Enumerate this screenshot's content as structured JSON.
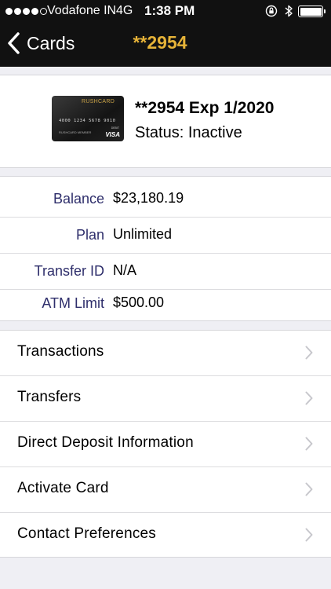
{
  "status_bar": {
    "carrier": "Vodafone IN",
    "network": "4G",
    "time": "1:38 PM"
  },
  "nav": {
    "back_label": "Cards",
    "title": "**2954",
    "title_color": "#e6b338"
  },
  "card": {
    "brand": "RUSHCARD",
    "number": "4000 1234 5678 9010",
    "member": "RUSHCARD MEMBER",
    "debit": "DEBIT",
    "network": "VISA",
    "title": "**2954 Exp 1/2020",
    "status": "Status: Inactive"
  },
  "details": [
    {
      "label": "Balance",
      "value": "$23,180.19"
    },
    {
      "label": "Plan",
      "value": "Unlimited"
    },
    {
      "label": "Transfer ID",
      "value": "N/A"
    },
    {
      "label": "ATM Limit",
      "value": "$500.00"
    }
  ],
  "menu": [
    {
      "label": "Transactions"
    },
    {
      "label": "Transfers"
    },
    {
      "label": "Direct Deposit Information"
    },
    {
      "label": "Activate Card"
    },
    {
      "label": "Contact Preferences"
    }
  ],
  "colors": {
    "nav_bg": "#111111",
    "label_color": "#2e2e6b",
    "page_bg": "#efeff4"
  },
  "icons": {
    "back": "chevron-left-icon",
    "row": "chevron-right-icon",
    "lock": "rotation-lock-icon",
    "bluetooth": "bluetooth-icon",
    "battery": "battery-icon"
  }
}
